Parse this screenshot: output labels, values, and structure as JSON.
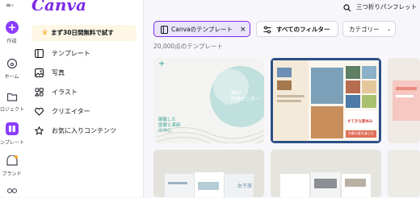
{
  "rail": {
    "top_label": "≡‹",
    "items": [
      {
        "label": "作成"
      },
      {
        "label": "ホーム"
      },
      {
        "label": "ロジェクト"
      },
      {
        "label": "ンプレート"
      },
      {
        "label": "ブランド"
      },
      {
        "label": ""
      }
    ]
  },
  "panel": {
    "logo": "Canva",
    "trial_label": "まず30日間無料で試す",
    "nav": [
      {
        "label": "テンプレート",
        "icon": "template-icon"
      },
      {
        "label": "写真",
        "icon": "photo-icon"
      },
      {
        "label": "イラスト",
        "icon": "elements-icon"
      },
      {
        "label": "クリエイター",
        "icon": "creator-icon"
      },
      {
        "label": "お気に入りコンテンツ",
        "icon": "star-icon"
      }
    ]
  },
  "search": {
    "query": "三つ折りパンフレット"
  },
  "filters": {
    "active_chip": "Canvaのテンプレート",
    "all_filters": "すべてのフィルター",
    "category": "カテゴリー"
  },
  "results_count": "20,000点のテンプレート",
  "cards": [
    {
      "heading": "高山\n医療センター",
      "tagline": "厳籠した\n医療と革新\nの中心"
    },
    {
      "heading": "すてきな夏休み",
      "banner": "京都の夏を楽しむ"
    },
    {
      "heading": "女子旅"
    },
    {}
  ],
  "colors": {
    "accent": "#7d2ae8",
    "rail_active": "#8b3dff",
    "trial_bg": "#fff7e6"
  }
}
